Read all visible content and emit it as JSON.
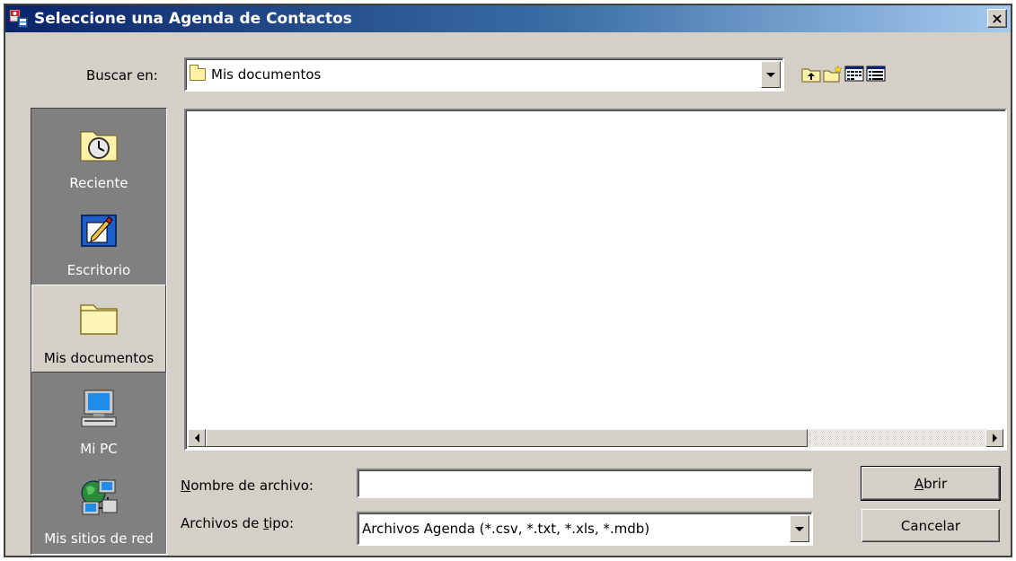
{
  "window": {
    "title": "Seleccione una Agenda de Contactos",
    "close_label": "×"
  },
  "look_in": {
    "label": "Buscar en:",
    "value": "Mis documentos"
  },
  "toolbar": {
    "icons": [
      "up-one-level-icon",
      "new-folder-icon",
      "list-view-icon",
      "details-view-icon"
    ]
  },
  "places": [
    {
      "label": "Reciente",
      "icon": "recent-clock-icon"
    },
    {
      "label": "Escritorio",
      "icon": "desktop-icon"
    },
    {
      "label": "Mis documentos",
      "icon": "folder-icon",
      "selected": true
    },
    {
      "label": "Mi PC",
      "icon": "computer-icon"
    },
    {
      "label": "Mis sitios de red",
      "icon": "network-places-icon"
    }
  ],
  "file_name": {
    "label_pre": "",
    "label_accel": "N",
    "label_post": "ombre de archivo:",
    "value": ""
  },
  "file_type": {
    "label_pre": "Archivos de ",
    "label_accel": "t",
    "label_post": "ipo:",
    "value": "Archivos Agenda (*.csv, *.txt, *.xls, *.mdb)"
  },
  "buttons": {
    "open_accel": "A",
    "open_rest": "brir",
    "cancel": "Cancelar"
  },
  "colors": {
    "title_start": "#0a246a",
    "title_end": "#a6caf0",
    "face": "#d4d0c8",
    "places_bg": "#808080"
  }
}
